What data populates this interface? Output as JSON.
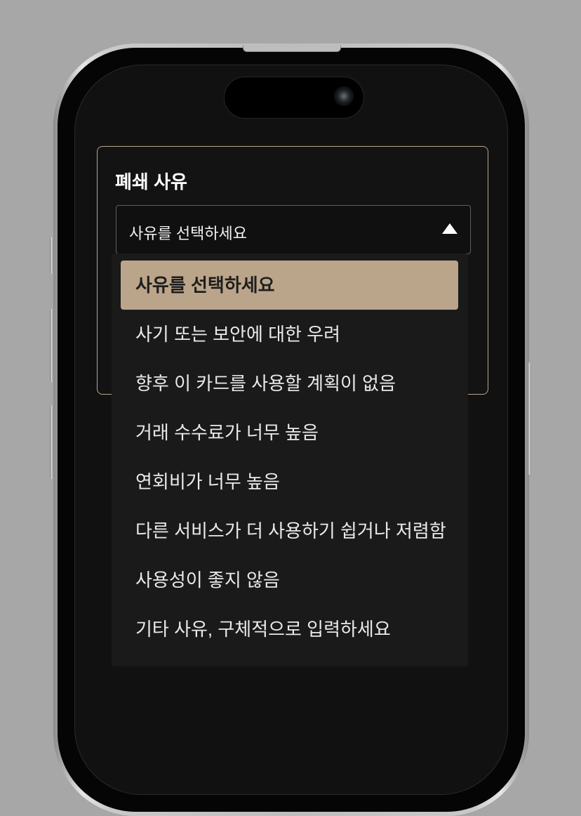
{
  "form": {
    "title": "폐쇄 사유",
    "select_value": "사유를 선택하세요"
  },
  "dropdown": {
    "options": [
      "사유를 선택하세요",
      "사기 또는 보안에 대한 우려",
      "향후 이 카드를 사용할 계획이 없음",
      "거래 수수료가 너무 높음",
      "연회비가 너무 높음",
      "다른 서비스가 더 사용하기 쉽거나 저렴함",
      "사용성이 좋지 않음",
      "기타 사유, 구체적으로 입력하세요"
    ],
    "selected_index": 0
  },
  "colors": {
    "accent": "#bba58a",
    "screen_bg": "#111111",
    "dropdown_bg": "#1a1a1a",
    "background": "#a7a7a7"
  },
  "icons": {
    "select_arrow": "triangle-up-icon",
    "camera": "camera-icon"
  }
}
